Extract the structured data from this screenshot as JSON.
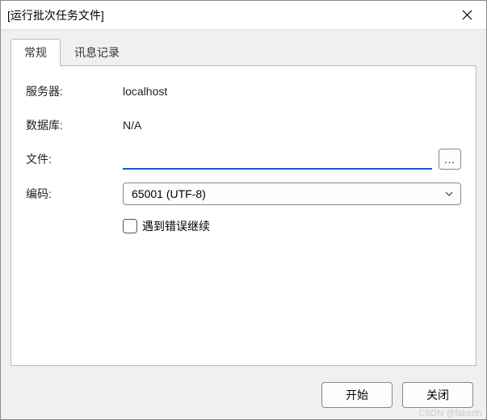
{
  "window": {
    "title": "[运行批次任务文件]"
  },
  "tabs": {
    "general": "常规",
    "log": "讯息记录"
  },
  "form": {
    "server_label": "服务器:",
    "server_value": "localhost",
    "database_label": "数据库:",
    "database_value": "N/A",
    "file_label": "文件:",
    "file_value": "",
    "browse_label": "...",
    "encoding_label": "编码:",
    "encoding_value": "65001 (UTF-8)",
    "continue_on_error_label": "遇到错误继续"
  },
  "footer": {
    "start": "开始",
    "close": "关闭"
  },
  "watermark": "CSDN @fakerth"
}
